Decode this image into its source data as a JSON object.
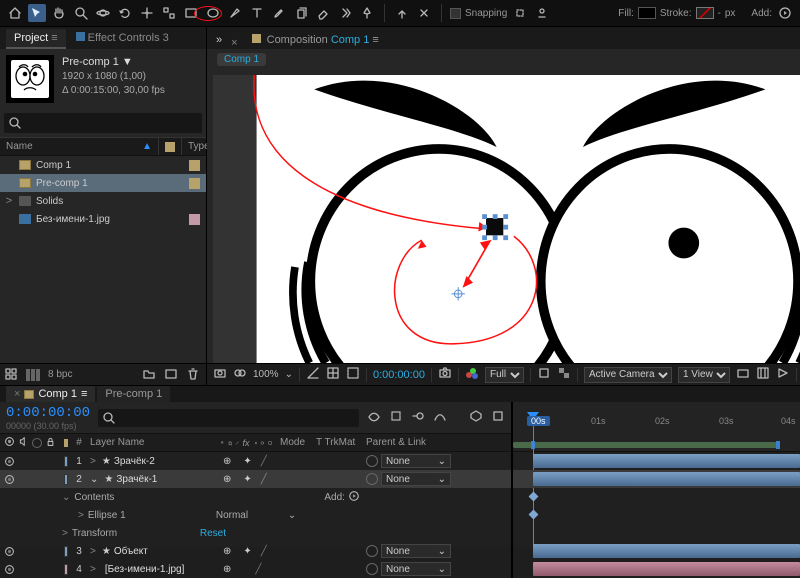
{
  "toolbar": {
    "snapping_label": "Snapping",
    "fill_label": "Fill:",
    "stroke_label": "Stroke:",
    "px_label": "px",
    "add_label": "Add:",
    "stroke_width": "-"
  },
  "project": {
    "tab_project": "Project",
    "tab_fx": "Effect Controls 3",
    "item_name": "Pre-comp 1",
    "dims": "1920 x 1080 (1,00)",
    "dur": "Δ 0:00:15:00, 30,00 fps",
    "col_name": "Name",
    "col_type": "Type",
    "rows": [
      {
        "icon": "comp",
        "label": "Comp 1"
      },
      {
        "icon": "comp",
        "label": "Pre-comp 1",
        "sel": true
      },
      {
        "icon": "folder",
        "label": "Solids",
        "expander": ">"
      },
      {
        "icon": "image",
        "label": "Без-имени-1.jpg"
      }
    ],
    "bpc": "8 bpc"
  },
  "comp": {
    "tab_label": "Composition",
    "tab_link": "Comp 1",
    "crumb": "Comp 1",
    "footer": {
      "zoom": "100%",
      "tc": "0:00:00:00",
      "res": "Full",
      "cam": "Active Camera",
      "views": "1 View"
    }
  },
  "timeline": {
    "tab1": "Comp 1",
    "tab2": "Pre-comp 1",
    "tc": "0:00:00:00",
    "fps": "00000 (30.00 fps)",
    "search_ph": "",
    "col_idx": "#",
    "col_name": "Layer Name",
    "col_mode": "Mode",
    "col_trk": "T  TrkMat",
    "col_parent": "Parent & Link",
    "add_label": "Add:",
    "rows": [
      {
        "idx": "1",
        "name": "Зрачёк-2",
        "star": true,
        "sw": "⊕",
        "parent": "None"
      },
      {
        "idx": "2",
        "name": "Зрачёк-1",
        "star": true,
        "sel": true,
        "sw": "⊕",
        "parent": "None"
      },
      {
        "sub": "Contents",
        "add": true
      },
      {
        "sub": "Ellipse 1",
        "mode": "Normal",
        "indent": 1
      },
      {
        "sub": "Transform",
        "reset": "Reset",
        "indent": 0
      },
      {
        "idx": "3",
        "name": "Объект",
        "star": true,
        "sw": "⊕",
        "parent": "None"
      },
      {
        "idx": "4",
        "name": "[Без-имени-1.jpg]",
        "img": true,
        "sw": "⊕",
        "parent": "None"
      }
    ],
    "ruler": [
      "00s",
      "01s",
      "02s",
      "03s",
      "04s"
    ]
  }
}
